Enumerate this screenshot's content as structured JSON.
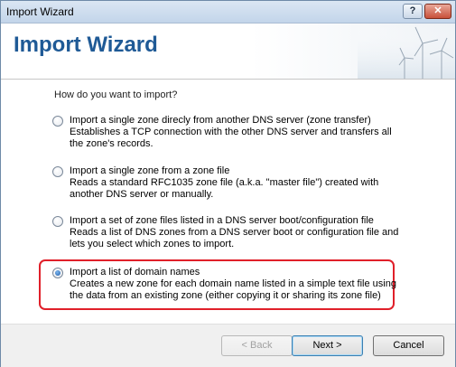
{
  "window": {
    "title": "Import Wizard",
    "help_button": "?",
    "close_button": "✕"
  },
  "banner": {
    "title": "Import Wizard"
  },
  "question": "How do you want to import?",
  "options": [
    {
      "title": "Import a single zone direcly from another DNS server (zone transfer)",
      "description": "Establishes a TCP connection with the other DNS server and transfers all the zone's records.",
      "selected": false
    },
    {
      "title": "Import a single zone from a zone file",
      "description": "Reads a standard RFC1035 zone file (a.k.a. \"master file\") created with another DNS server or manually.",
      "selected": false
    },
    {
      "title": "Import a set of zone files listed in a DNS server boot/configuration file",
      "description": "Reads a list of DNS zones from a DNS server boot or configuration file and lets you select which zones to import.",
      "selected": false
    },
    {
      "title": "Import a list of domain names",
      "description": "Creates a new zone for each domain name listed in a simple text file using the data from an existing zone (either copying it or sharing its zone file)",
      "selected": true
    }
  ],
  "buttons": {
    "back": "< Back",
    "next": "Next >",
    "cancel": "Cancel"
  },
  "colors": {
    "banner_title": "#1f5a96",
    "highlight_border": "#e0202a"
  }
}
